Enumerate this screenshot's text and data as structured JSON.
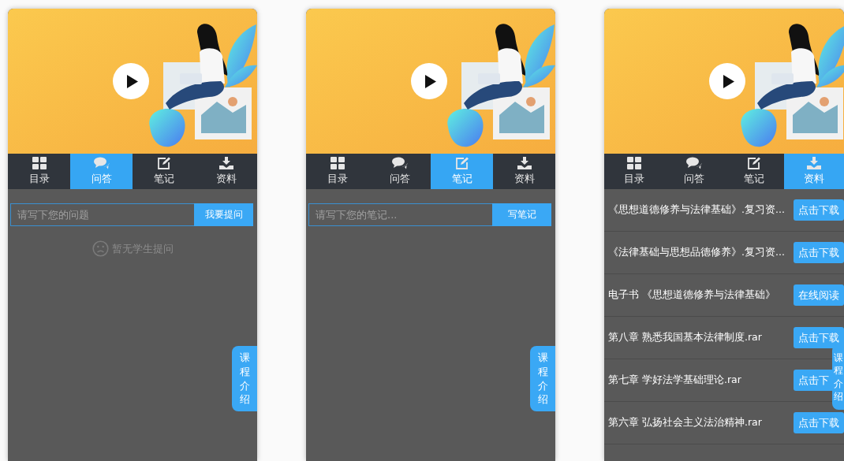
{
  "panels": [
    {
      "tabs": [
        {
          "label": "目录",
          "selected": false
        },
        {
          "label": "问答",
          "selected": true
        },
        {
          "label": "笔记",
          "selected": false
        },
        {
          "label": "资料",
          "selected": false
        }
      ],
      "content": {
        "kind": "qa",
        "placeholder": "请写下您的问题",
        "button": "我要提问",
        "empty_text": "暂无学生提问"
      },
      "side_tab": "课程介绍"
    },
    {
      "tabs": [
        {
          "label": "目录",
          "selected": false
        },
        {
          "label": "问答",
          "selected": false
        },
        {
          "label": "笔记",
          "selected": true
        },
        {
          "label": "资料",
          "selected": false
        }
      ],
      "content": {
        "kind": "notes",
        "placeholder": "请写下您的笔记...",
        "button": "写笔记"
      },
      "side_tab": "课程介绍"
    },
    {
      "tabs": [
        {
          "label": "目录",
          "selected": false
        },
        {
          "label": "问答",
          "selected": false
        },
        {
          "label": "笔记",
          "selected": false
        },
        {
          "label": "资料",
          "selected": true
        }
      ],
      "content": {
        "kind": "files",
        "items": [
          {
            "title": "《思想道德修养与法律基础》.复习资...",
            "button": "点击下载"
          },
          {
            "title": "《法律基础与思想品德修养》.复习资...",
            "button": "点击下载"
          },
          {
            "title": "电子书 《思想道德修养与法律基础》",
            "button": "在线阅读"
          },
          {
            "title": "第八章 熟悉我国基本法律制度.rar",
            "button": "点击下载"
          },
          {
            "title": "第七章 学好法学基础理论.rar",
            "button": "点击下"
          },
          {
            "title": "第六章 弘扬社会主义法治精神.rar",
            "button": "点击下载"
          }
        ]
      },
      "side_tab": "课程介绍"
    }
  ]
}
